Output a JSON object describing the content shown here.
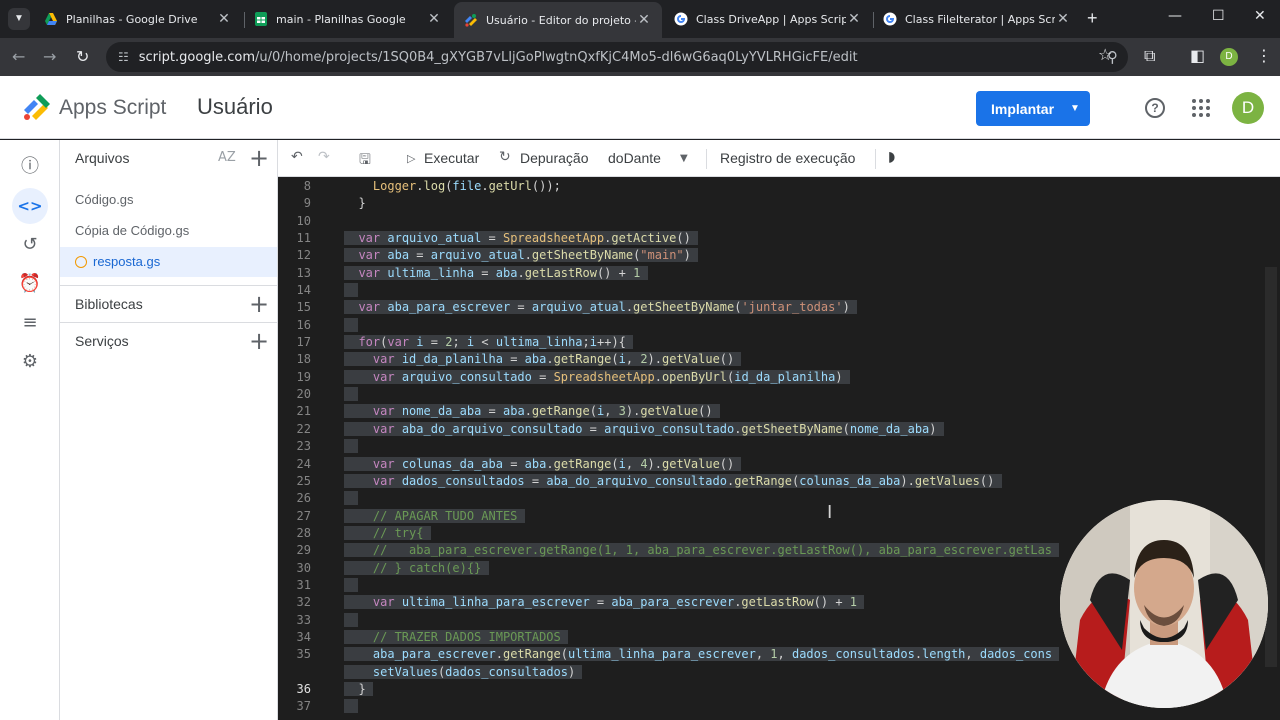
{
  "browser": {
    "tabs": [
      {
        "title": "Planilhas - Google Drive",
        "icon": "google-drive-icon",
        "active": false
      },
      {
        "title": "main - Planilhas Google",
        "icon": "google-sheets-icon",
        "active": false
      },
      {
        "title": "Usuário - Editor do projeto - Apps Script",
        "icon": "apps-script-icon",
        "active": true
      },
      {
        "title": "Class DriveApp | Apps Script",
        "icon": "google-icon",
        "active": false
      },
      {
        "title": "Class FileIterator | Apps Script",
        "icon": "google-icon",
        "active": false
      }
    ],
    "url_host": "script.google.com",
    "url_path": "/u/0/home/projects/1SQ0B4_gXYGB7vLIjGoPlwgtnQxfKjC4Mo5-dl6wG6aq0LyYVLRHGicFE/edit",
    "profile_initial": "D"
  },
  "app": {
    "name": "Apps Script",
    "project": "Usuário",
    "deploy_label": "Implantar",
    "avatar_initial": "D"
  },
  "files_panel": {
    "header": "Arquivos",
    "sort_label": "AZ",
    "files": [
      "Código.gs",
      "Cópia de Código.gs",
      "resposta.gs"
    ],
    "libraries": "Bibliotecas",
    "services": "Serviços"
  },
  "editor_toolbar": {
    "run": "Executar",
    "debug": "Depuração",
    "function": "doDante",
    "log": "Registro de execução"
  },
  "code": {
    "current_line": 36,
    "lines": [
      {
        "n": "8",
        "text": "    Logger.log(file.getUrl());"
      },
      {
        "n": "9",
        "text": "  }"
      },
      {
        "n": "10",
        "text": ""
      },
      {
        "n": "11",
        "text": "  var arquivo_atual = SpreadsheetApp.getActive()"
      },
      {
        "n": "12",
        "text": "  var aba = arquivo_atual.getSheetByName(\"main\")"
      },
      {
        "n": "13",
        "text": "  var ultima_linha = aba.getLastRow() + 1"
      },
      {
        "n": "14",
        "text": ""
      },
      {
        "n": "15",
        "text": "  var aba_para_escrever = arquivo_atual.getSheetByName('juntar_todas')"
      },
      {
        "n": "16",
        "text": ""
      },
      {
        "n": "17",
        "text": "  for(var i = 2; i < ultima_linha;i++){"
      },
      {
        "n": "18",
        "text": "    var id_da_planilha = aba.getRange(i, 2).getValue()"
      },
      {
        "n": "19",
        "text": "    var arquivo_consultado = SpreadsheetApp.openByUrl(id_da_planilha)"
      },
      {
        "n": "20",
        "text": ""
      },
      {
        "n": "21",
        "text": "    var nome_da_aba = aba.getRange(i, 3).getValue()"
      },
      {
        "n": "22",
        "text": "    var aba_do_arquivo_consultado = arquivo_consultado.getSheetByName(nome_da_aba)"
      },
      {
        "n": "23",
        "text": ""
      },
      {
        "n": "24",
        "text": "    var colunas_da_aba = aba.getRange(i, 4).getValue()"
      },
      {
        "n": "25",
        "text": "    var dados_consultados = aba_do_arquivo_consultado.getRange(colunas_da_aba).getValues()"
      },
      {
        "n": "26",
        "text": ""
      },
      {
        "n": "27",
        "text": "    // APAGAR TUDO ANTES"
      },
      {
        "n": "28",
        "text": "    // try{"
      },
      {
        "n": "29",
        "text": "    //   aba_para_escrever.getRange(1, 1, aba_para_escrever.getLastRow(), aba_para_escrever.getLas"
      },
      {
        "n": "30",
        "text": "    // } catch(e){}"
      },
      {
        "n": "31",
        "text": ""
      },
      {
        "n": "32",
        "text": "    var ultima_linha_para_escrever = aba_para_escrever.getLastRow() + 1"
      },
      {
        "n": "33",
        "text": ""
      },
      {
        "n": "34",
        "text": "    // TRAZER DADOS IMPORTADOS"
      },
      {
        "n": "35",
        "text": "    aba_para_escrever.getRange(ultima_linha_para_escrever, 1, dados_consultados.length, dados_cons"
      },
      {
        "n": "",
        "text": "    setValues(dados_consultados)"
      },
      {
        "n": "36",
        "text": "  }"
      },
      {
        "n": "37",
        "text": ""
      }
    ]
  },
  "colors": {
    "accent": "#1a73e8",
    "editor_bg": "#1e1e1e",
    "selection": "#3a3d41"
  }
}
